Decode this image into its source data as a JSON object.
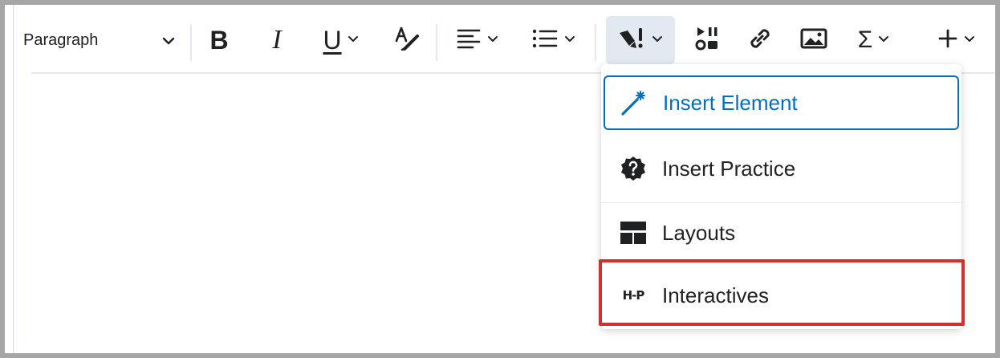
{
  "toolbar": {
    "format_label": "Paragraph",
    "buttons": [
      {
        "icon": "bold-icon",
        "glyph": "B"
      },
      {
        "icon": "italic-icon",
        "glyph": "I"
      },
      {
        "icon": "underline-icon",
        "glyph": "U"
      }
    ]
  },
  "menu": {
    "items": [
      {
        "label": "Insert Element",
        "icon": "magic-wand-icon"
      },
      {
        "label": "Insert Practice",
        "icon": "question-badge-icon"
      },
      {
        "label": "Layouts",
        "icon": "layout-icon"
      },
      {
        "label": "Interactives",
        "icon": "h5p-logo-icon",
        "logo_text": "H-P"
      }
    ]
  },
  "colors": {
    "accent": "#006fbf",
    "highlight": "#d32f2f",
    "text": "#202122",
    "toolbar_active": "#e3e9f1"
  }
}
